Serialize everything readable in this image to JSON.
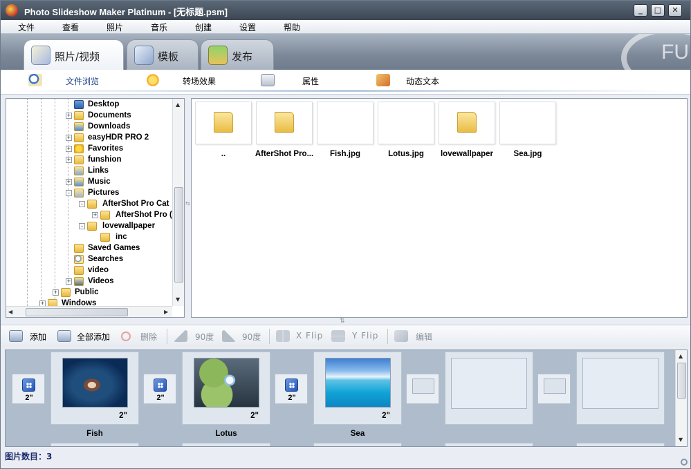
{
  "window": {
    "title": "Photo Slideshow Maker Platinum - [无标题.psm]"
  },
  "menu": [
    "文件",
    "查看",
    "照片",
    "音乐",
    "创建",
    "设置",
    "帮助"
  ],
  "main_tabs": [
    {
      "label": "照片/视频",
      "active": true
    },
    {
      "label": "模板",
      "active": false
    },
    {
      "label": "发布",
      "active": false
    }
  ],
  "logo_text": "FU",
  "sub_tabs": [
    "文件浏览",
    "转场效果",
    "属性",
    "动态文本"
  ],
  "tree": [
    {
      "label": "Desktop",
      "expander": ""
    },
    {
      "label": "Documents",
      "expander": "+"
    },
    {
      "label": "Downloads",
      "expander": ""
    },
    {
      "label": "easyHDR PRO 2",
      "expander": "+"
    },
    {
      "label": "Favorites",
      "expander": "+"
    },
    {
      "label": "funshion",
      "expander": "+"
    },
    {
      "label": "Links",
      "expander": ""
    },
    {
      "label": "Music",
      "expander": "+"
    },
    {
      "label": "Pictures",
      "expander": "-"
    },
    {
      "label": "AfterShot Pro Cat",
      "expander": "-"
    },
    {
      "label": "AfterShot Pro (",
      "expander": "+"
    },
    {
      "label": "lovewallpaper",
      "expander": "-"
    },
    {
      "label": "inc",
      "expander": ""
    },
    {
      "label": "Saved Games",
      "expander": ""
    },
    {
      "label": "Searches",
      "expander": ""
    },
    {
      "label": "video",
      "expander": ""
    },
    {
      "label": "Videos",
      "expander": "+"
    },
    {
      "label": "Public",
      "expander": "+"
    },
    {
      "label": "Windows",
      "expander": "+"
    }
  ],
  "files": [
    {
      "name": "..",
      "kind": "folder"
    },
    {
      "name": "AfterShot Pro...",
      "kind": "folder"
    },
    {
      "name": "Fish.jpg",
      "kind": "fish"
    },
    {
      "name": "Lotus.jpg",
      "kind": "lotus"
    },
    {
      "name": "lovewallpaper",
      "kind": "folder"
    },
    {
      "name": "Sea.jpg",
      "kind": "sea"
    }
  ],
  "toolbar": {
    "add": "添加",
    "add_all": "全部添加",
    "delete": "删除",
    "rotate_left": "90度",
    "rotate_right": "90度",
    "x_flip": "X Flip",
    "y_flip": "Y Flip",
    "edit": "编辑"
  },
  "storyboard": {
    "transitions": [
      "2\"",
      "2\"",
      "2\""
    ],
    "slides": [
      {
        "name": "Fish",
        "duration": "2\"",
        "kind": "fish"
      },
      {
        "name": "Lotus",
        "duration": "2\"",
        "kind": "lotus"
      },
      {
        "name": "Sea",
        "duration": "2\"",
        "kind": "sea"
      }
    ]
  },
  "status": {
    "text": "图片数目：3"
  }
}
